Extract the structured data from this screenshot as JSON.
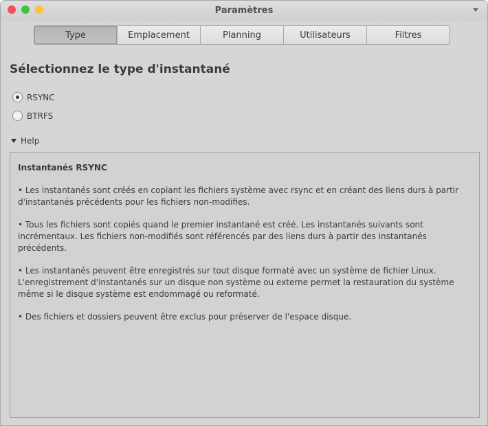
{
  "window": {
    "title": "Paramètres"
  },
  "tabs": [
    {
      "label": "Type",
      "active": true
    },
    {
      "label": "Emplacement",
      "active": false
    },
    {
      "label": "Planning",
      "active": false
    },
    {
      "label": "Utilisateurs",
      "active": false
    },
    {
      "label": "Filtres",
      "active": false
    }
  ],
  "heading": "Sélectionnez le type d'instantané",
  "options": [
    {
      "label": "RSYNC",
      "selected": true
    },
    {
      "label": "BTRFS",
      "selected": false
    }
  ],
  "help": {
    "toggle_label": "Help",
    "title": "Instantanés RSYNC",
    "paragraphs": [
      "• Les instantanés sont créés en copiant les fichiers système avec rsync et en créant des liens durs à partir d'instantanés précédents pour les fichiers non-modifies.",
      "• Tous les fichiers sont copiés quand le premier instantané est créé. Les instantanés suivants sont incrémentaux. Les fichiers non-modifiés sont référencés par des liens durs à partir des instantanés précédents.",
      "• Les instantanés peuvent être enregistrés sur tout disque formaté avec un système de fichier Linux. L'enregistrement d'instantanés sur un disque non système ou externe permet la restauration du système même si le disque système est endommagé ou reformaté.",
      "• Des fichiers et dossiers peuvent être exclus pour préserver de l'espace disque."
    ]
  },
  "colors": {
    "close": "#f25056",
    "minimize": "#39c349",
    "maximize": "#fac536",
    "window_bg": "#d6d6d6"
  }
}
